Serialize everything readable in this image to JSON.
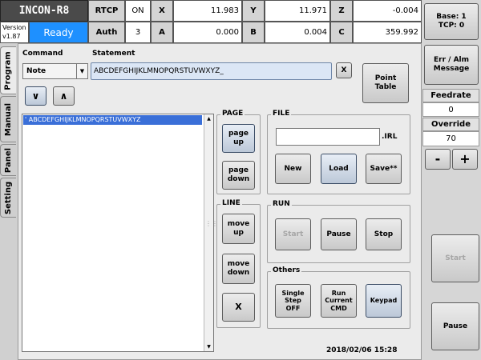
{
  "app": {
    "title": "INCON-R8",
    "version_label": "Version",
    "version": "v1.87",
    "status": "Ready"
  },
  "header": {
    "rtcp_label": "RTCP",
    "rtcp_value": "ON",
    "auth_label": "Auth",
    "auth_value": "3",
    "x_label": "X",
    "x_value": "11.983",
    "y_label": "Y",
    "y_value": "11.971",
    "z_label": "Z",
    "z_value": "-0.004",
    "a_label": "A",
    "a_value": "0.000",
    "b_label": "B",
    "b_value": "0.004",
    "c_label": "C",
    "c_value": "359.992"
  },
  "tabs": [
    "Program",
    "Manual",
    "Panel",
    "Setting"
  ],
  "program": {
    "command_label": "Command",
    "statement_label": "Statement",
    "command_value": "Note",
    "statement_value": "ABCDEFGHIJKLMNOPQRSTUVWXYZ_",
    "clear_label": "X",
    "point_table_label": "Point Table",
    "down_label": "∨",
    "up_label": "∧",
    "lines": [
      "' ABCDEFGHIJKLMNOPQRSTUVWXYZ"
    ]
  },
  "page_group": {
    "title": "PAGE",
    "page_up": "page up",
    "page_down": "page down"
  },
  "line_group": {
    "title": "LINE",
    "move_up": "move up",
    "move_down": "move down",
    "delete": "X"
  },
  "file_group": {
    "title": "FILE",
    "filename": "",
    "extension": ".IRL",
    "new": "New",
    "load": "Load",
    "save": "Save**"
  },
  "run_group": {
    "title": "RUN",
    "start": "Start",
    "pause": "Pause",
    "stop": "Stop"
  },
  "others_group": {
    "title": "Others",
    "single_step": "Single Step OFF",
    "run_current": "Run Current CMD",
    "keypad": "Keypad"
  },
  "datetime": "2018/02/06 15:28",
  "right_panel": {
    "base_tcp": "Base: 1 TCP: 0",
    "err_alm": "Err / Alm Message",
    "feedrate_label": "Feedrate",
    "feedrate_value": "0",
    "override_label": "Override",
    "override_value": "70",
    "minus": "-",
    "plus": "+",
    "start": "Start",
    "pause": "Pause"
  },
  "colors": {
    "ready": "#1e90ff",
    "selection": "#3a6fd8",
    "statement_bg": "#dbe6f5"
  }
}
